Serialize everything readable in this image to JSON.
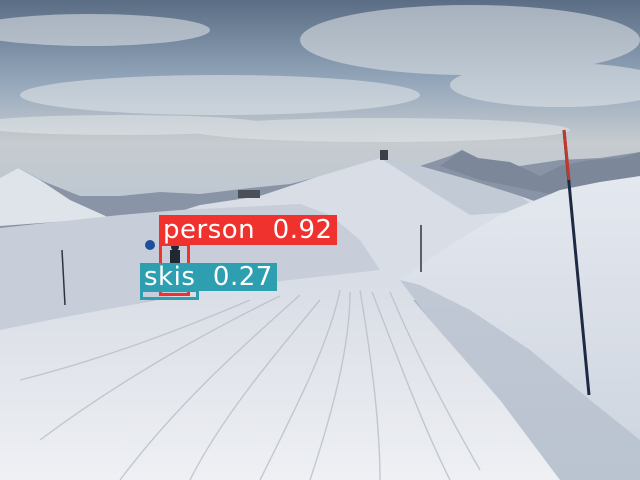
{
  "detections": [
    {
      "label": "person",
      "score": "0.92",
      "color": "#f0322f"
    },
    {
      "label": "skis",
      "score": "0.27",
      "color": "#2e9fb0"
    }
  ],
  "colors": {
    "sky_top": "#5f7288",
    "sky_mid": "#aebccb",
    "sky_horizon": "#c9cfd4",
    "snow": "#e9ecf1",
    "snow_shadow": "#c9d0dc",
    "mountains": "#8a97a8",
    "pole": "#1e2a44",
    "pole_tip": "#c0392b"
  }
}
